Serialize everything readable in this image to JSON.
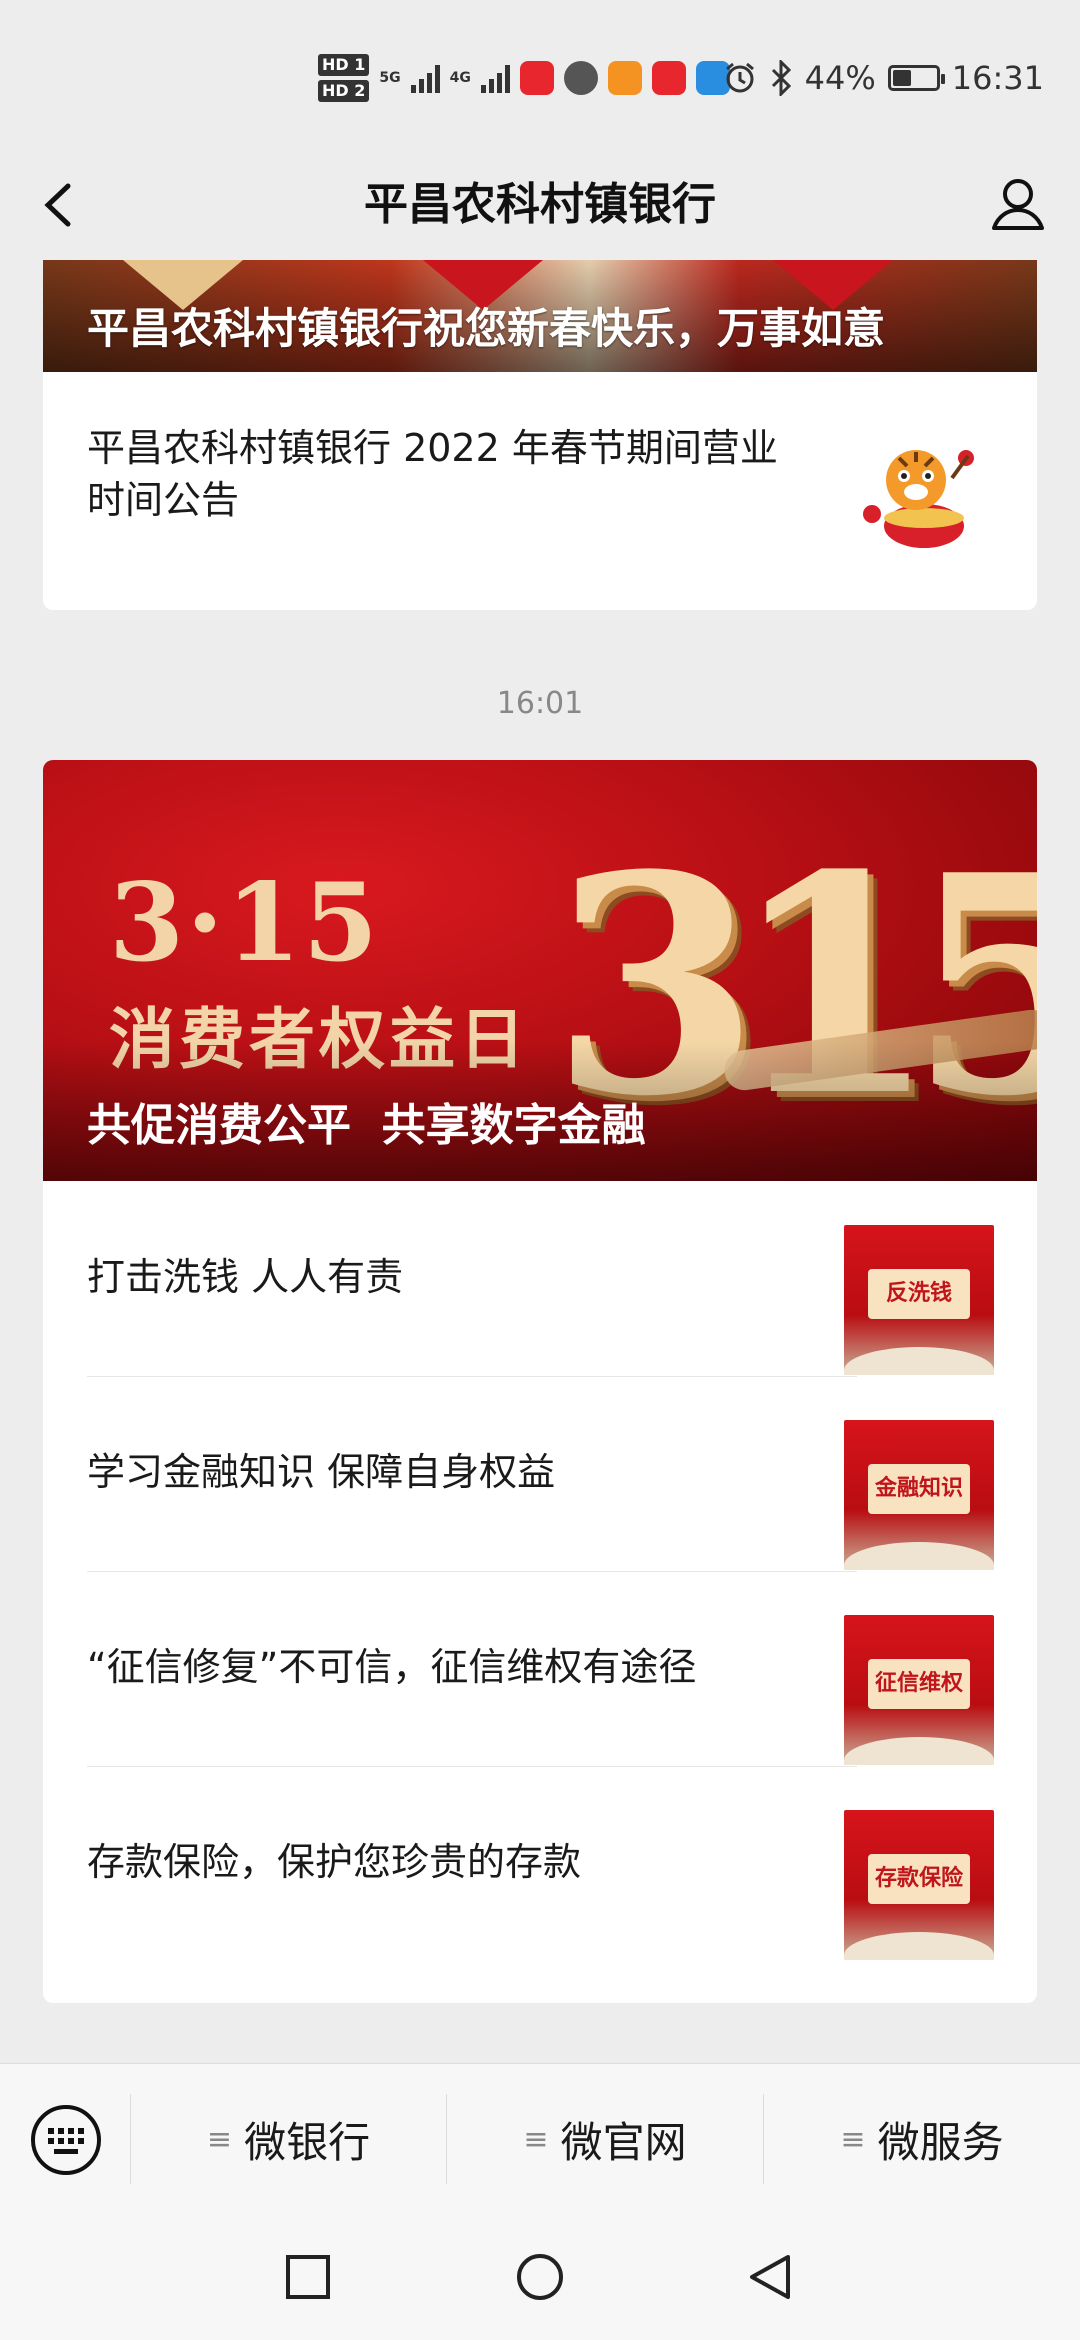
{
  "status_bar": {
    "hd1": "HD 1",
    "hd2": "HD 2",
    "net1": "5G",
    "net2": "4G",
    "battery_text": "44%",
    "battery_level": 0.44,
    "time": "16:31"
  },
  "header": {
    "title": "平昌农科村镇银行"
  },
  "feed": {
    "card1": {
      "banner_caption": "平昌农科村镇银行祝您新春快乐，万事如意",
      "article_line1": "平昌农科村镇银行 2022 年春节期间营业",
      "article_line2": "时间公告"
    },
    "timestamp": "16:01",
    "card2": {
      "banner_date": "3·15",
      "banner_subtitle": "消费者权益日",
      "banner_big": "315",
      "banner_caption": "共促消费公平  共享数字金融",
      "items": [
        {
          "title": "打击洗钱 人人有责",
          "thumb_label": "反洗钱"
        },
        {
          "title": "学习金融知识  保障自身权益",
          "thumb_label": "金融知识"
        },
        {
          "title": "“征信修复”不可信，征信维权有途径",
          "thumb_label": "征信维权"
        },
        {
          "title": "存款保险，保护您珍贵的存款",
          "thumb_label": "存款保险"
        }
      ]
    }
  },
  "menu": {
    "items": [
      {
        "label": "微银行"
      },
      {
        "label": "微官网"
      },
      {
        "label": "微服务"
      }
    ]
  },
  "colors": {
    "brand_red": "#c9151e",
    "background": "#ededed"
  }
}
